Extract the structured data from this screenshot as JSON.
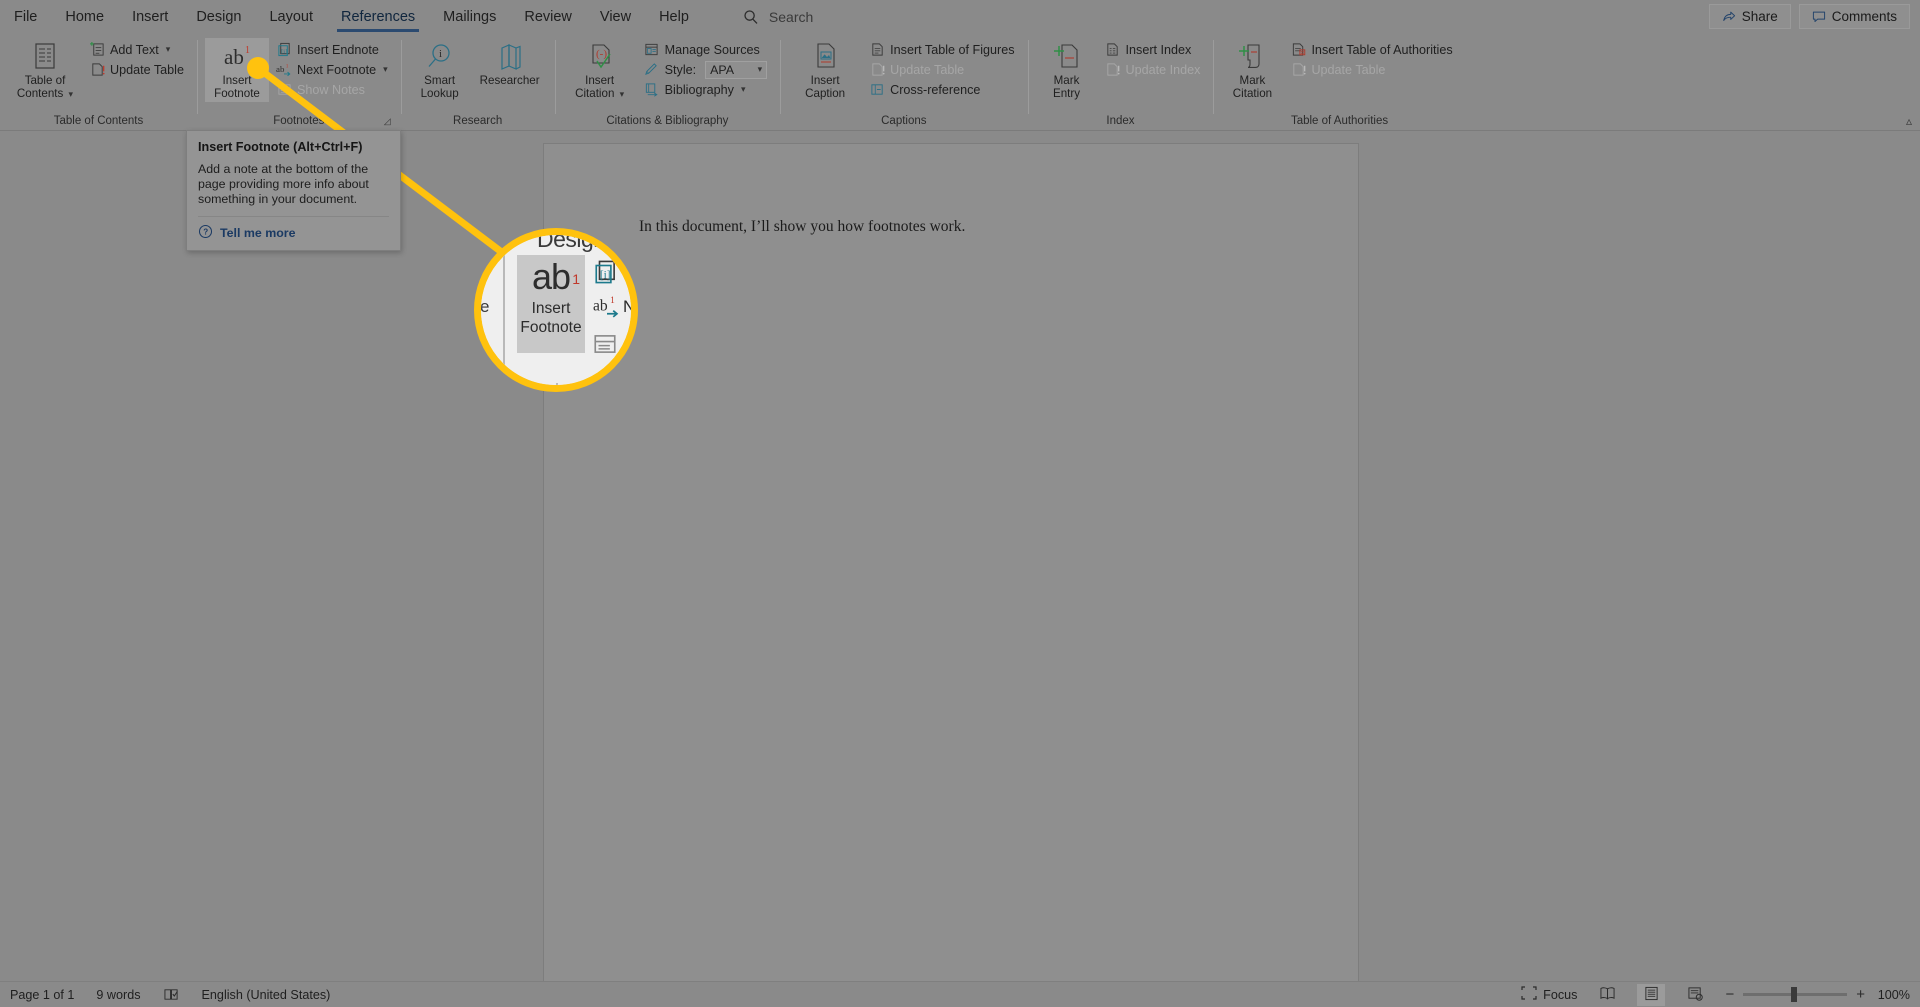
{
  "app": {
    "accent_yellow": "#ffc20e",
    "chrome_bg": "#8a8a8a",
    "tab_underline": "#2b4a70"
  },
  "tabbar": {
    "tabs": [
      {
        "label": "File",
        "active": false
      },
      {
        "label": "Home",
        "active": false
      },
      {
        "label": "Insert",
        "active": false
      },
      {
        "label": "Design",
        "active": false
      },
      {
        "label": "Layout",
        "active": false
      },
      {
        "label": "References",
        "active": true
      },
      {
        "label": "Mailings",
        "active": false
      },
      {
        "label": "Review",
        "active": false
      },
      {
        "label": "View",
        "active": false
      },
      {
        "label": "Help",
        "active": false
      }
    ],
    "search": {
      "placeholder": "Search",
      "value": "",
      "icon": "search-icon"
    },
    "share_label": "Share",
    "comments_label": "Comments"
  },
  "ribbon": {
    "groups": [
      {
        "label": "Table of Contents",
        "big": [
          {
            "label_line1": "Table of",
            "label_line2": "Contents",
            "caret": true,
            "icon": "table-of-contents-icon"
          }
        ],
        "small": [
          {
            "label": "Add Text",
            "caret": true,
            "disabled": false,
            "icon": "add-text-icon"
          },
          {
            "label": "Update Table",
            "caret": false,
            "disabled": false,
            "icon": "update-table-icon"
          }
        ]
      },
      {
        "label": "Footnotes",
        "dialog_launcher": true,
        "big": [
          {
            "label_line1": "Insert",
            "label_line2": "Footnote",
            "caret": false,
            "icon": "insert-footnote-icon",
            "highlighted": true
          }
        ],
        "small": [
          {
            "label": "Insert Endnote",
            "caret": false,
            "disabled": false,
            "icon": "insert-endnote-icon"
          },
          {
            "label": "Next Footnote",
            "caret": true,
            "disabled": false,
            "icon": "next-footnote-icon"
          },
          {
            "label": "Show Notes",
            "caret": false,
            "disabled": true,
            "icon": "show-notes-icon"
          }
        ]
      },
      {
        "label": "Research",
        "big": [
          {
            "label_line1": "Smart",
            "label_line2": "Lookup",
            "caret": false,
            "icon": "smart-lookup-icon"
          },
          {
            "label_line1": "Researcher",
            "label_line2": "",
            "caret": false,
            "icon": "researcher-icon"
          }
        ],
        "small": []
      },
      {
        "label": "Citations & Bibliography",
        "big": [
          {
            "label_line1": "Insert",
            "label_line2": "Citation",
            "caret": true,
            "icon": "insert-citation-icon"
          }
        ],
        "small": [
          {
            "label": "Manage Sources",
            "caret": false,
            "disabled": false,
            "icon": "manage-sources-icon"
          },
          {
            "label": "Style:",
            "caret": false,
            "disabled": false,
            "icon": "style-icon",
            "select": {
              "value": "APA"
            }
          },
          {
            "label": "Bibliography",
            "caret": true,
            "disabled": false,
            "icon": "bibliography-icon"
          }
        ]
      },
      {
        "label": "Captions",
        "big": [
          {
            "label_line1": "Insert",
            "label_line2": "Caption",
            "caret": false,
            "icon": "insert-caption-icon"
          }
        ],
        "small": [
          {
            "label": "Insert Table of Figures",
            "caret": false,
            "disabled": false,
            "icon": "insert-table-of-figures-icon"
          },
          {
            "label": "Update Table",
            "caret": false,
            "disabled": true,
            "icon": "update-table-icon"
          },
          {
            "label": "Cross-reference",
            "caret": false,
            "disabled": false,
            "icon": "cross-reference-icon"
          }
        ]
      },
      {
        "label": "Index",
        "big": [
          {
            "label_line1": "Mark",
            "label_line2": "Entry",
            "caret": false,
            "icon": "mark-entry-icon"
          }
        ],
        "small": [
          {
            "label": "Insert Index",
            "caret": false,
            "disabled": false,
            "icon": "insert-index-icon"
          },
          {
            "label": "Update Index",
            "caret": false,
            "disabled": true,
            "icon": "update-index-icon"
          }
        ]
      },
      {
        "label": "Table of Authorities",
        "big": [
          {
            "label_line1": "Mark",
            "label_line2": "Citation",
            "caret": false,
            "icon": "mark-citation-icon"
          }
        ],
        "small": [
          {
            "label": "Insert Table of Authorities",
            "caret": false,
            "disabled": false,
            "icon": "insert-table-of-authorities-icon"
          },
          {
            "label": "Update Table",
            "caret": false,
            "disabled": true,
            "icon": "update-table-icon"
          }
        ]
      }
    ],
    "collapse_icon": "chevron-up-icon"
  },
  "tooltip": {
    "title": "Insert Footnote (Alt+Ctrl+F)",
    "body": "Add a note at the bottom of the page providing more info about something in your document.",
    "link": "Tell me more",
    "help_icon": "question-circle-icon"
  },
  "magnifier": {
    "partial_tab_label": "Design",
    "partial_left_label": "e",
    "button": {
      "ab": "ab",
      "superscript": "1",
      "line1": "Insert",
      "line2": "Footnote"
    },
    "side_label": "N"
  },
  "document": {
    "body_text": "In this document, I’ll show you how footnotes work."
  },
  "statusbar": {
    "page": "Page 1 of 1",
    "words": "9 words",
    "proofing_icon": "proofing-icon",
    "language": "English (United States)",
    "focus_label": "Focus",
    "focus_icon": "focus-icon",
    "views": [
      {
        "name": "read-mode",
        "icon": "read-mode-icon",
        "active": false
      },
      {
        "name": "print-layout",
        "icon": "print-layout-icon",
        "active": true
      },
      {
        "name": "web-layout",
        "icon": "web-layout-icon",
        "active": false
      }
    ],
    "zoom_out": "−",
    "zoom_in": "+",
    "zoom_level": "100%"
  }
}
